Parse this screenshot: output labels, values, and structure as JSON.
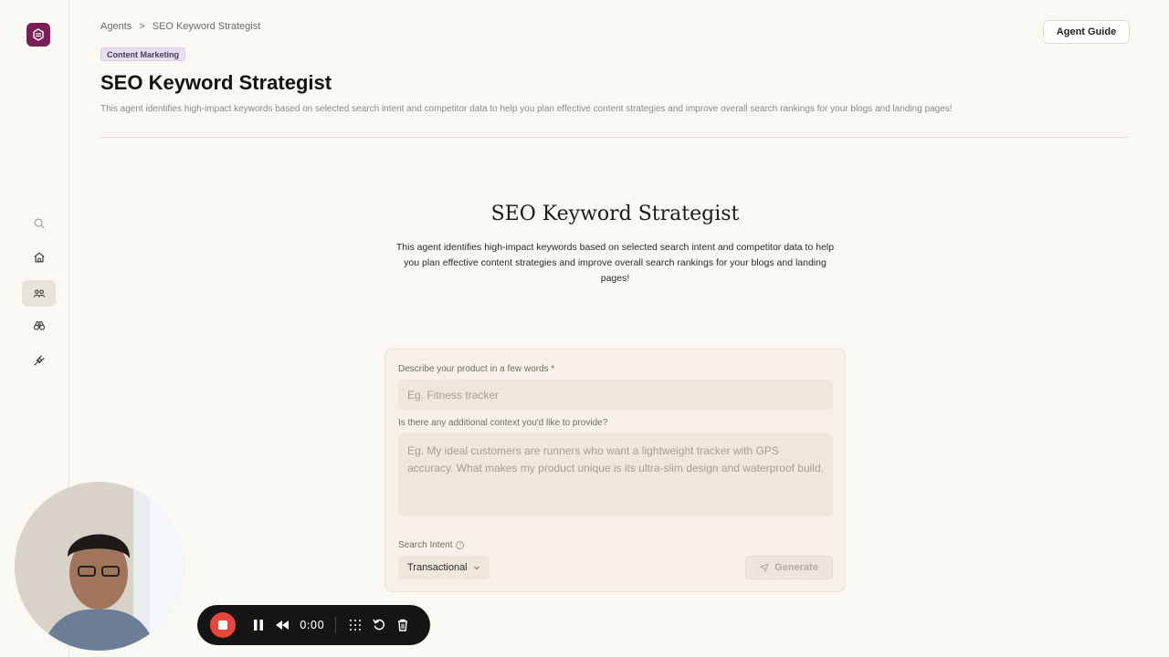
{
  "breadcrumb": {
    "root": "Agents",
    "separator": ">",
    "current": "SEO Keyword Strategist"
  },
  "header": {
    "badge": "Content Marketing",
    "title": "SEO Keyword Strategist",
    "description": "This agent identifies high-impact keywords based on selected search intent and competitor data to help you plan effective content strategies and improve overall search rankings for your blogs and landing pages!",
    "guide_button": "Agent Guide"
  },
  "sidebar": {
    "items": [
      {
        "name": "search",
        "icon": "search-icon"
      },
      {
        "name": "home",
        "icon": "home-icon"
      },
      {
        "name": "agents",
        "icon": "people-icon",
        "active": true
      },
      {
        "name": "explore",
        "icon": "binoculars-icon"
      },
      {
        "name": "integrations",
        "icon": "plug-icon"
      }
    ]
  },
  "agent": {
    "heading": "SEO Keyword Strategist",
    "description": "This agent identifies high-impact keywords based on selected search intent and competitor data to help you plan effective content strategies and improve overall search rankings for your blogs and landing pages!"
  },
  "form": {
    "product_label": "Describe your product in a few words *",
    "product_placeholder": "Eg. Fitness tracker",
    "context_label": "Is there any additional context you'd like to provide?",
    "context_placeholder": "Eg. My ideal customers are runners who want a lightweight tracker with GPS accuracy. What makes my product unique is its ultra-slim design and waterproof build.",
    "intent_label": "Search Intent",
    "intent_value": "Transactional",
    "generate_label": "Generate"
  },
  "recorder": {
    "time": "0:00"
  },
  "colors": {
    "accent": "#7a1f55",
    "record": "#e8453c"
  }
}
